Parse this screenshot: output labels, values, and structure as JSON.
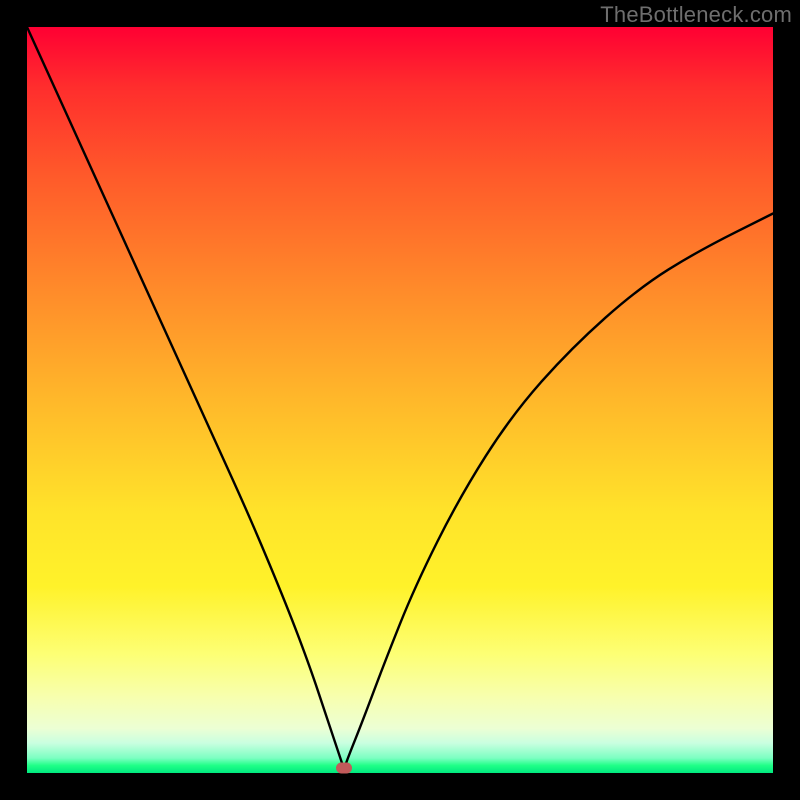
{
  "watermark": "TheBottleneck.com",
  "chart_data": {
    "type": "line",
    "title": "",
    "xlabel": "",
    "ylabel": "",
    "xlim": [
      0,
      100
    ],
    "ylim": [
      0,
      100
    ],
    "series": [
      {
        "name": "bottleneck-curve",
        "x": [
          0,
          5,
          10,
          15,
          20,
          25,
          30,
          35,
          38,
          40,
          41,
          42,
          42.5,
          43,
          45,
          48,
          52,
          58,
          65,
          73,
          82,
          90,
          100
        ],
        "values": [
          100,
          89,
          78,
          67,
          56,
          45,
          34,
          22,
          14,
          8,
          5,
          2,
          0.5,
          2,
          7,
          15,
          25,
          37,
          48,
          57,
          65,
          70,
          75
        ]
      }
    ],
    "marker": {
      "x": 42.5,
      "y": 0.7,
      "color": "#c25a5a"
    },
    "gradient_stops": [
      {
        "pos": 0,
        "color": "#ff0033"
      },
      {
        "pos": 50,
        "color": "#ffb82a"
      },
      {
        "pos": 75,
        "color": "#fff22a"
      },
      {
        "pos": 100,
        "color": "#00e87f"
      }
    ]
  }
}
